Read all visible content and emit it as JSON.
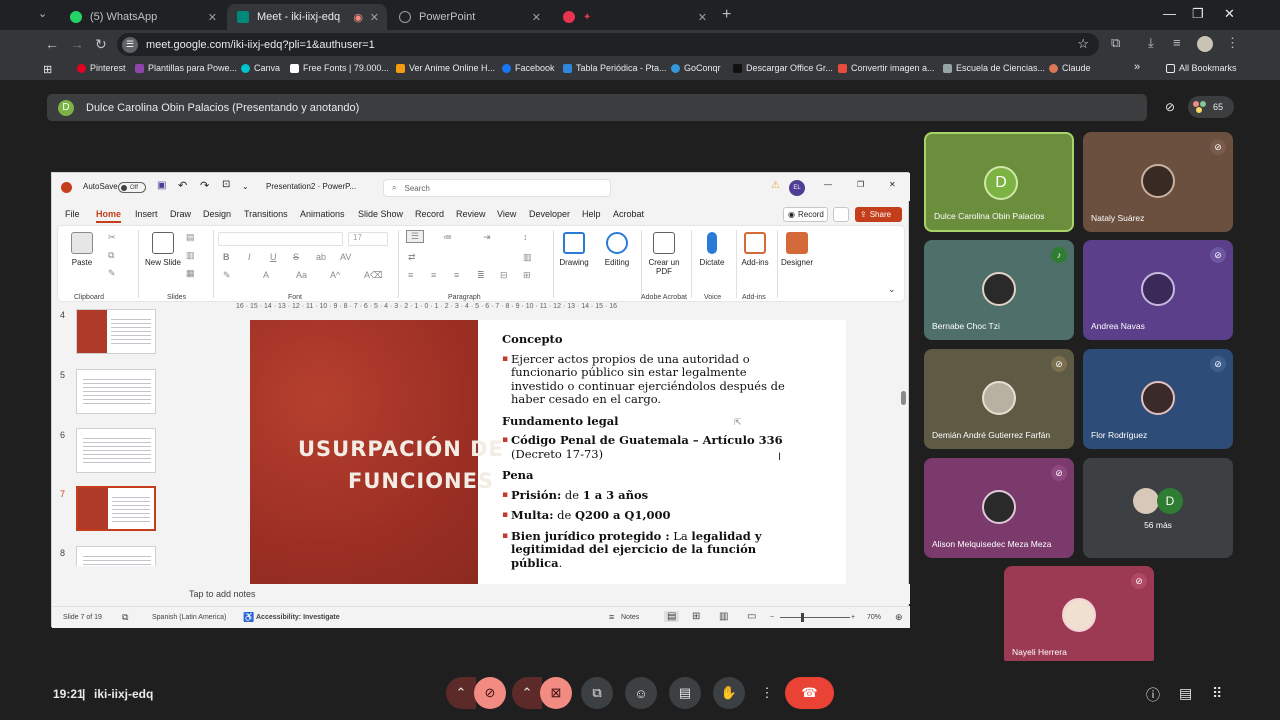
{
  "browser": {
    "tabs": [
      {
        "title": "(5) WhatsApp",
        "active": false,
        "color": "#25d366"
      },
      {
        "title": "Meet - iki-iixj-edq",
        "active": true,
        "color": "#00897b"
      },
      {
        "title": "PowerPoint",
        "active": false,
        "color": "#9aa0a6"
      }
    ],
    "url": "meet.google.com/iki-iixj-edq?pli=1&authuser=1",
    "bookmarks": [
      {
        "label": "Pinterest",
        "color": "#e60023"
      },
      {
        "label": "Plantillas para Powe...",
        "color": "#8e44ad"
      },
      {
        "label": "Canva",
        "color": "#00c4cc"
      },
      {
        "label": "Free Fonts | 79.000...",
        "color": "#ffffff"
      },
      {
        "label": "Ver Anime Online H...",
        "color": "#f39c12"
      },
      {
        "label": "Facebook",
        "color": "#1877f2"
      },
      {
        "label": "Tabla Periódica - Pta...",
        "color": "#2e86de"
      },
      {
        "label": "GoConqr",
        "color": "#3498db"
      },
      {
        "label": "Descargar Office Gr...",
        "color": "#111111"
      },
      {
        "label": "Convertir imagen a...",
        "color": "#e74c3c"
      },
      {
        "label": "Escuela de Ciencias...",
        "color": "#95a5a6"
      },
      {
        "label": "Claude",
        "color": "#d97757"
      }
    ],
    "all_bookmarks": "All Bookmarks"
  },
  "meet": {
    "presenter_initial": "D",
    "presenter_text": "Dulce Carolina Obin Palacios (Presentando y anotando)",
    "participant_count": "65",
    "time": "19:21",
    "meeting_code": "iki-iixj-edq",
    "participants": [
      {
        "name": "Dulce Carolina Obin Palacios",
        "initial": "D",
        "bg": "#6a8e3c",
        "muted": false
      },
      {
        "name": "Nataly Suárez",
        "bg": "#6b4f3f",
        "muted": true
      },
      {
        "name": "Bernabe Choc Tzi",
        "bg": "#4f6f6a",
        "muted": false
      },
      {
        "name": "Andrea Navas",
        "bg": "#5b3f8a",
        "muted": true
      },
      {
        "name": "Demián André Gutierrez Farfán",
        "bg": "#5f5a44",
        "muted": true
      },
      {
        "name": "Flor Rodríguez",
        "bg": "#2e4c78",
        "muted": true
      },
      {
        "name": "Alison Melquisedec Meza Meza",
        "bg": "#7a3a6b",
        "muted": true
      },
      {
        "name": "56 más",
        "initial": "D"
      },
      {
        "name": "Nayeli Herrera",
        "bg": "#9b3a52",
        "muted": true
      }
    ]
  },
  "ppt": {
    "autosave": "AutoSave",
    "autosave_state": "Off",
    "filename": "Presentation2 · PowerP...",
    "search_placeholder": "Search",
    "avatar": "EL",
    "menu": [
      "File",
      "Home",
      "Insert",
      "Draw",
      "Design",
      "Transitions",
      "Animations",
      "Slide Show",
      "Record",
      "Review",
      "View",
      "Developer",
      "Help",
      "Acrobat"
    ],
    "record": "Record",
    "share": "Share",
    "ribbon": {
      "paste": "Paste",
      "new_slide": "New Slide",
      "font_size": "17",
      "drawing": "Drawing",
      "editing": "Editing",
      "crear_pdf": "Crear un PDF",
      "dictate": "Dictate",
      "addins": "Add-ins",
      "designer": "Designer",
      "groups": [
        "Clipboard",
        "Slides",
        "Font",
        "Paragraph",
        "Adobe Acrobat",
        "Voice",
        "Add-ins"
      ]
    },
    "ruler": "16 · 15 · 14 · 13 · 12 · 11 · 10 · 9 · 8 · 7 · 6 · 5 · 4 · 3 · 2 · 1 · 0 · 1 · 2 · 3 · 4 · 5 · 6 · 7 · 8 · 9 · 10 · 11 · 12 · 13 · 14 · 15 · 16",
    "thumb_numbers": [
      "4",
      "5",
      "6",
      "7",
      "8"
    ],
    "slide": {
      "title1": "USURPACIÓN DE",
      "title2": "FUNCIONES",
      "h_concepto": "Concepto",
      "concepto": "Ejercer actos propios de una autoridad o funcionario público sin estar legalmente investido o continuar ejerciéndolos después de haber cesado en el cargo.",
      "h_fundamento": "Fundamento legal",
      "fundamento_bold": "Código Penal de Guatemala – Artículo 336",
      "fundamento_rest": "(Decreto 17-73)",
      "h_pena": "Pena",
      "prision_label": "Prisión:",
      "prision_de": " de ",
      "prision_value": "1 a 3 años",
      "multa_label": "Multa:",
      "multa_de": " de ",
      "multa_value": "Q200 a Q1,000",
      "bien_label": "Bien jurídico protegido :",
      "bien_la": " La ",
      "bien_value": "legalidad y legitimidad del ejercicio de la función pública",
      "bien_end": "."
    },
    "notes": "Tap to add notes",
    "status": {
      "slide": "Slide 7 of 19",
      "language": "Spanish (Latin America)",
      "accessibility": "Accessibility: Investigate",
      "notes": "Notes",
      "zoom": "70%"
    }
  }
}
